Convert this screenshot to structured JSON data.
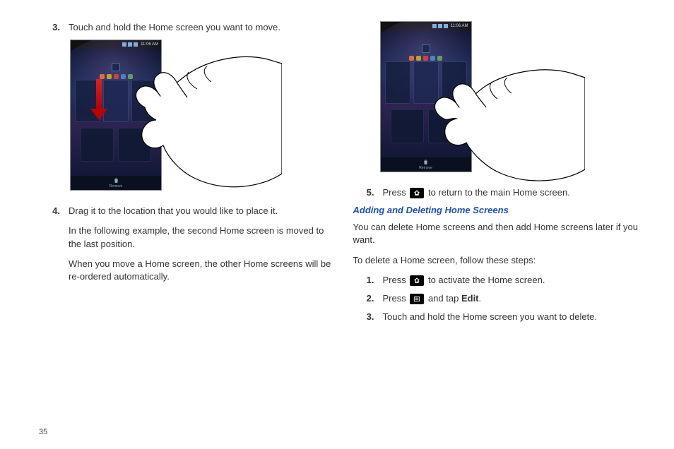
{
  "page_number": "35",
  "status_time": "11:06 AM",
  "trash_label": "Remove",
  "left": {
    "step3": {
      "num": "3.",
      "text": "Touch and hold the Home screen you want to move."
    },
    "step4": {
      "num": "4.",
      "line1": "Drag it to the location that you would like to place it.",
      "line2": "In the following example, the second Home screen is moved to the last position.",
      "line3": "When you move a Home screen, the other Home screens will be re-ordered automatically."
    }
  },
  "right": {
    "step5": {
      "num": "5.",
      "pre": "Press ",
      "post": " to return to the main Home screen."
    },
    "subhead": "Adding and Deleting Home Screens",
    "p1": "You can delete Home screens and then add Home screens later if you want.",
    "p2": "To delete a Home screen, follow these steps:",
    "s1": {
      "num": "1.",
      "pre": "Press ",
      "post": " to activate the Home screen."
    },
    "s2": {
      "num": "2.",
      "pre": "Press ",
      "mid": " and tap ",
      "edit": "Edit",
      "post": "."
    },
    "s3": {
      "num": "3.",
      "text": "Touch and hold the Home screen you want to delete."
    }
  }
}
